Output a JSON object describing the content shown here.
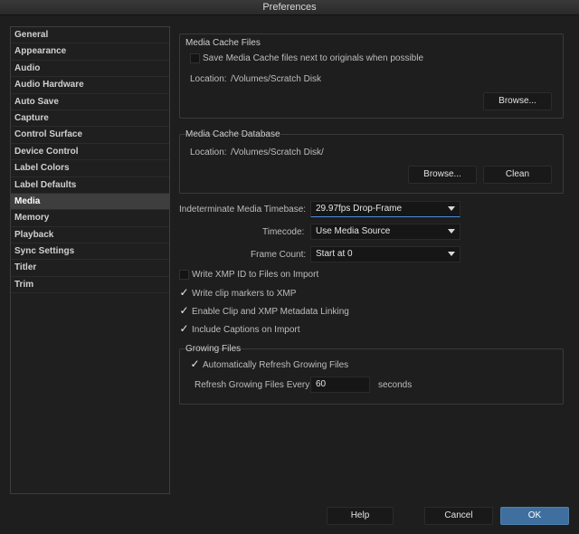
{
  "window": {
    "title": "Preferences"
  },
  "sidebar": {
    "selected_index": 11,
    "items": [
      {
        "label": "General"
      },
      {
        "label": "Appearance"
      },
      {
        "label": "Audio"
      },
      {
        "label": "Audio Hardware"
      },
      {
        "label": "Auto Save"
      },
      {
        "label": "Capture"
      },
      {
        "label": "Control Surface"
      },
      {
        "label": "Device Control"
      },
      {
        "label": "Label Colors"
      },
      {
        "label": "Label Defaults"
      },
      {
        "label": "Media"
      },
      {
        "label": "Memory"
      },
      {
        "label": "Playback"
      },
      {
        "label": "Sync Settings"
      },
      {
        "label": "Titler"
      },
      {
        "label": "Trim"
      }
    ]
  },
  "media_cache_files": {
    "title": "Media Cache Files",
    "save_next_to_originals": {
      "label": "Save Media Cache files next to originals when possible",
      "checked": false
    },
    "location_label": "Location:",
    "location_value": "/Volumes/Scratch Disk",
    "browse_label": "Browse..."
  },
  "media_cache_database": {
    "title": "Media Cache Database",
    "location_label": "Location:",
    "location_value": "/Volumes/Scratch Disk/",
    "browse_label": "Browse...",
    "clean_label": "Clean"
  },
  "timebase": {
    "label": "Indeterminate Media Timebase:",
    "value": "29.97fps Drop-Frame"
  },
  "timecode": {
    "label": "Timecode:",
    "value": "Use Media Source"
  },
  "frame_count": {
    "label": "Frame Count:",
    "value": "Start at 0"
  },
  "options": [
    {
      "label": "Write XMP ID to Files on Import",
      "checked": false
    },
    {
      "label": "Write clip markers to XMP",
      "checked": true
    },
    {
      "label": "Enable Clip and XMP Metadata Linking",
      "checked": true
    },
    {
      "label": "Include Captions on Import",
      "checked": true
    }
  ],
  "growing_files": {
    "title": "Growing Files",
    "auto_refresh": {
      "label": "Automatically Refresh Growing Files",
      "checked": true
    },
    "refresh_label": "Refresh Growing Files Every",
    "refresh_value": "60",
    "unit_label": "seconds"
  },
  "footer": {
    "help_label": "Help",
    "cancel_label": "Cancel",
    "ok_label": "OK"
  },
  "colors": {
    "accent": "#3e6f9e",
    "selection": "#3e3e3e",
    "background": "#1e1e1e"
  },
  "icons": {
    "check": "✓",
    "dropdown": "chevron-down-icon"
  }
}
